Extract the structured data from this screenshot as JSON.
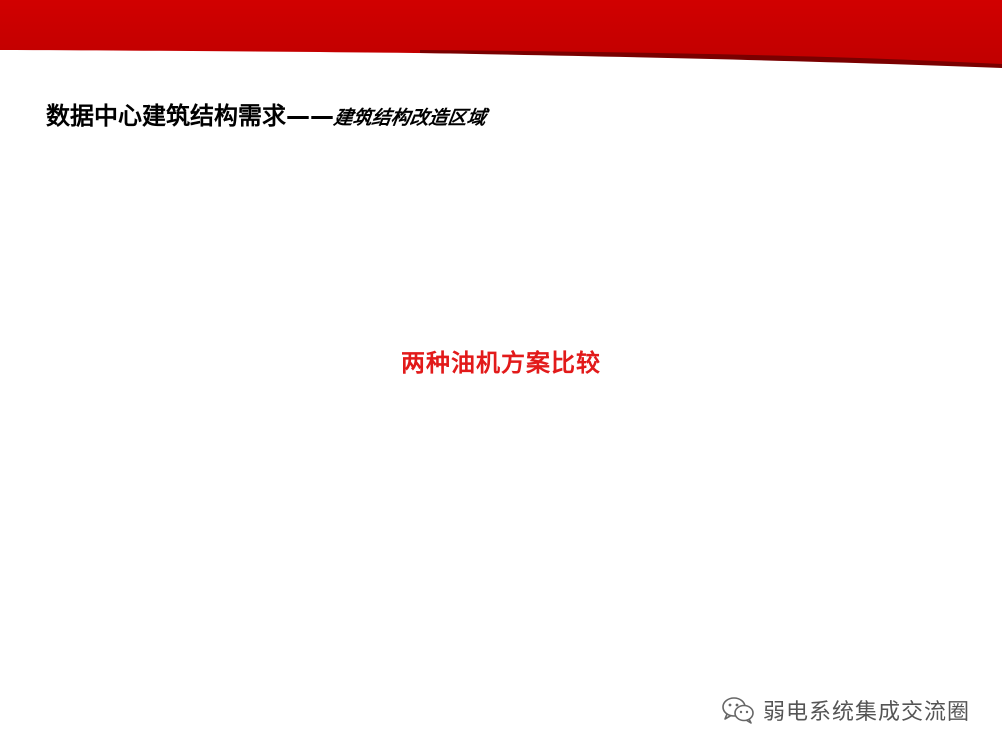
{
  "colors": {
    "header_band": "#cc0000",
    "header_band_dark": "#6a0000",
    "center_text": "#e21a1a",
    "watermark": "#555555"
  },
  "slide": {
    "title_main": "数据中心建筑结构需求——",
    "title_sub": "建筑结构改造区域",
    "center_text": "两种油机方案比较"
  },
  "watermark": {
    "icon": "wechat-icon",
    "text": "弱电系统集成交流圈"
  }
}
